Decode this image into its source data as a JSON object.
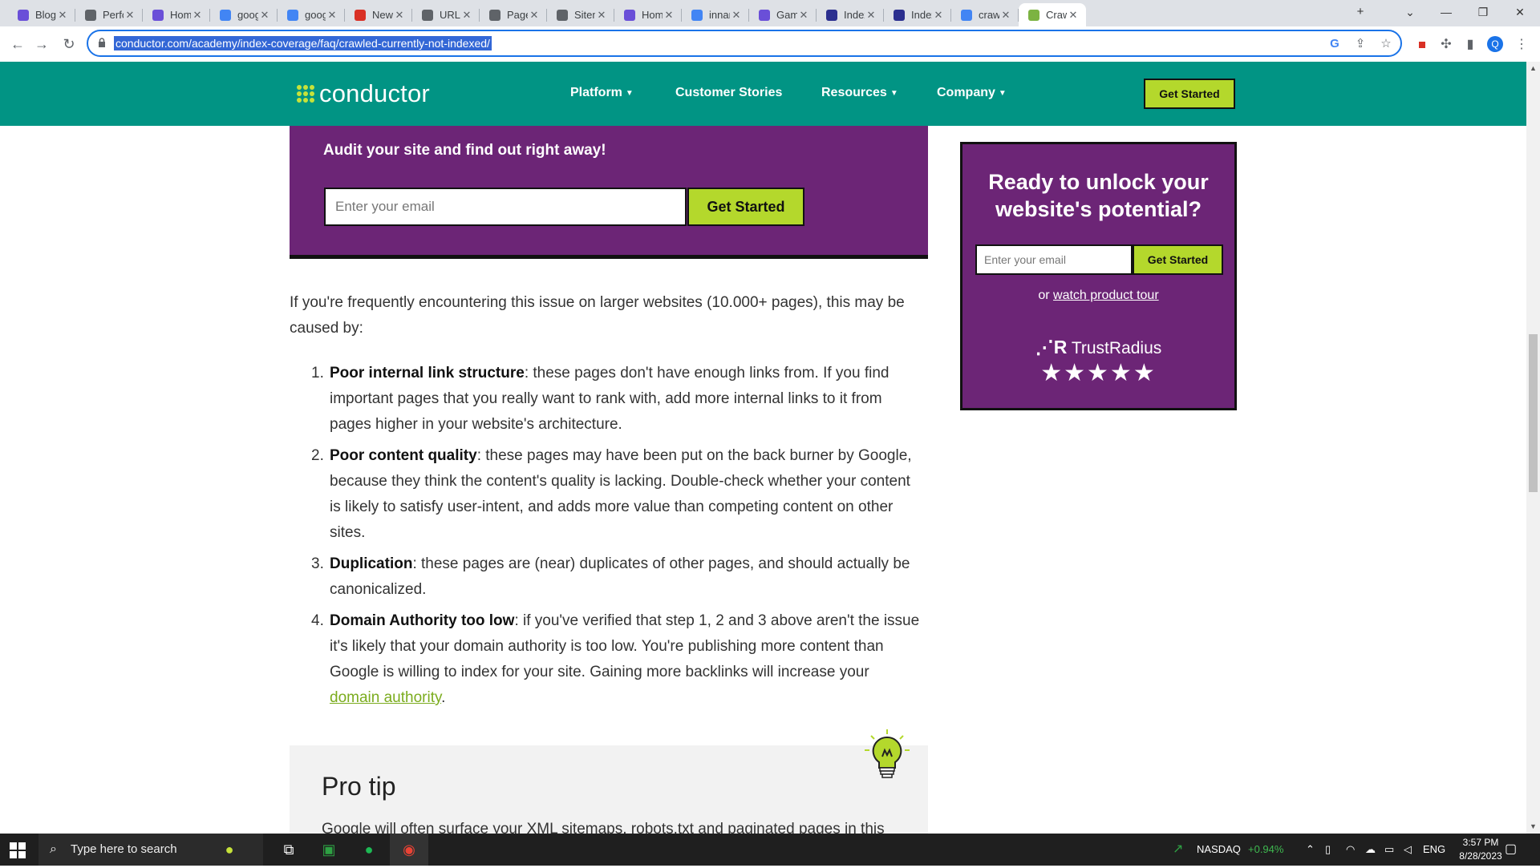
{
  "browser": {
    "tabs": [
      {
        "title": "Blog Ca",
        "favicon_color": "#6a4fd8"
      },
      {
        "title": "Perform",
        "favicon_color": "#5f6368"
      },
      {
        "title": "Home",
        "favicon_color": "#6a4fd8"
      },
      {
        "title": "google",
        "favicon_color": "#4285f4"
      },
      {
        "title": "google",
        "favicon_color": "#4285f4"
      },
      {
        "title": "New Pa",
        "favicon_color": "#d93025"
      },
      {
        "title": "URL Ins",
        "favicon_color": "#5f6368"
      },
      {
        "title": "Page in",
        "favicon_color": "#5f6368"
      },
      {
        "title": "Sitema",
        "favicon_color": "#5f6368"
      },
      {
        "title": "Home",
        "favicon_color": "#6a4fd8"
      },
      {
        "title": "innanc",
        "favicon_color": "#4285f4"
      },
      {
        "title": "Game",
        "favicon_color": "#6a4fd8"
      },
      {
        "title": "Indexin",
        "favicon_color": "#2b2f8f"
      },
      {
        "title": "Indexin",
        "favicon_color": "#2b2f8f"
      },
      {
        "title": "crawle",
        "favicon_color": "#4285f4"
      },
      {
        "title": "Crawle",
        "favicon_color": "#7cb342",
        "active": true
      }
    ],
    "url": "conductor.com/academy/index-coverage/faq/crawled-currently-not-indexed/",
    "profile_initial": "Q"
  },
  "header": {
    "logo": "conductor",
    "nav": [
      {
        "label": "Platform",
        "has_caret": true
      },
      {
        "label": "Customer Stories",
        "has_caret": false
      },
      {
        "label": "Resources",
        "has_caret": true
      },
      {
        "label": "Company",
        "has_caret": true
      }
    ],
    "cta": "Get Started"
  },
  "audit": {
    "title": "Audit your site and find out right away!",
    "email_placeholder": "Enter your email",
    "button": "Get Started"
  },
  "intro": "If you're frequently encountering this issue on larger websites (10.000+ pages), this may be caused by:",
  "causes": [
    {
      "num": "1.",
      "title": "Poor internal link structure",
      "text": ": these pages don't have enough links from. If you find important pages that you really want to rank with, add more internal links to it from pages higher in your website's architecture."
    },
    {
      "num": "2.",
      "title": "Poor content quality",
      "text": ": these pages may have been put on the back burner by Google, because they think the content's quality is lacking. Double-check whether your content is likely to satisfy user-intent, and adds more value than competing content on other sites."
    },
    {
      "num": "3.",
      "title": "Duplication",
      "text": ": these pages are (near) duplicates of other pages, and should actually be canonicalized."
    },
    {
      "num": "4.",
      "title": "Domain Authority too low",
      "text": ": if you've verified that step 1, 2 and 3 above aren't the issue it's likely that your domain authority is too low. You're publishing more content than Google is willing to index for your site. Gaining more backlinks will increase your ",
      "link": "domain authority",
      "after": "."
    }
  ],
  "protip": {
    "title": "Pro tip",
    "text": "Google will often surface your XML sitemaps, robots.txt and paginated pages in this"
  },
  "sidebar": {
    "title": "Ready to unlock your website's potential?",
    "email_placeholder": "Enter your email",
    "button": "Get Started",
    "tour_prefix": "or ",
    "tour_link": "watch product tour",
    "trust_brand": "TrustRadius",
    "stars": "★★★★★"
  },
  "taskbar": {
    "search_placeholder": "Type here to search",
    "stock_name": "NASDAQ",
    "stock_change": "+0.94%",
    "language": "ENG",
    "time": "3:57 PM",
    "date": "8/28/2023"
  },
  "colors": {
    "header_teal": "#019484",
    "purple": "#6c2576",
    "lime": "#b4d82c",
    "link_green": "#7bac1e"
  }
}
